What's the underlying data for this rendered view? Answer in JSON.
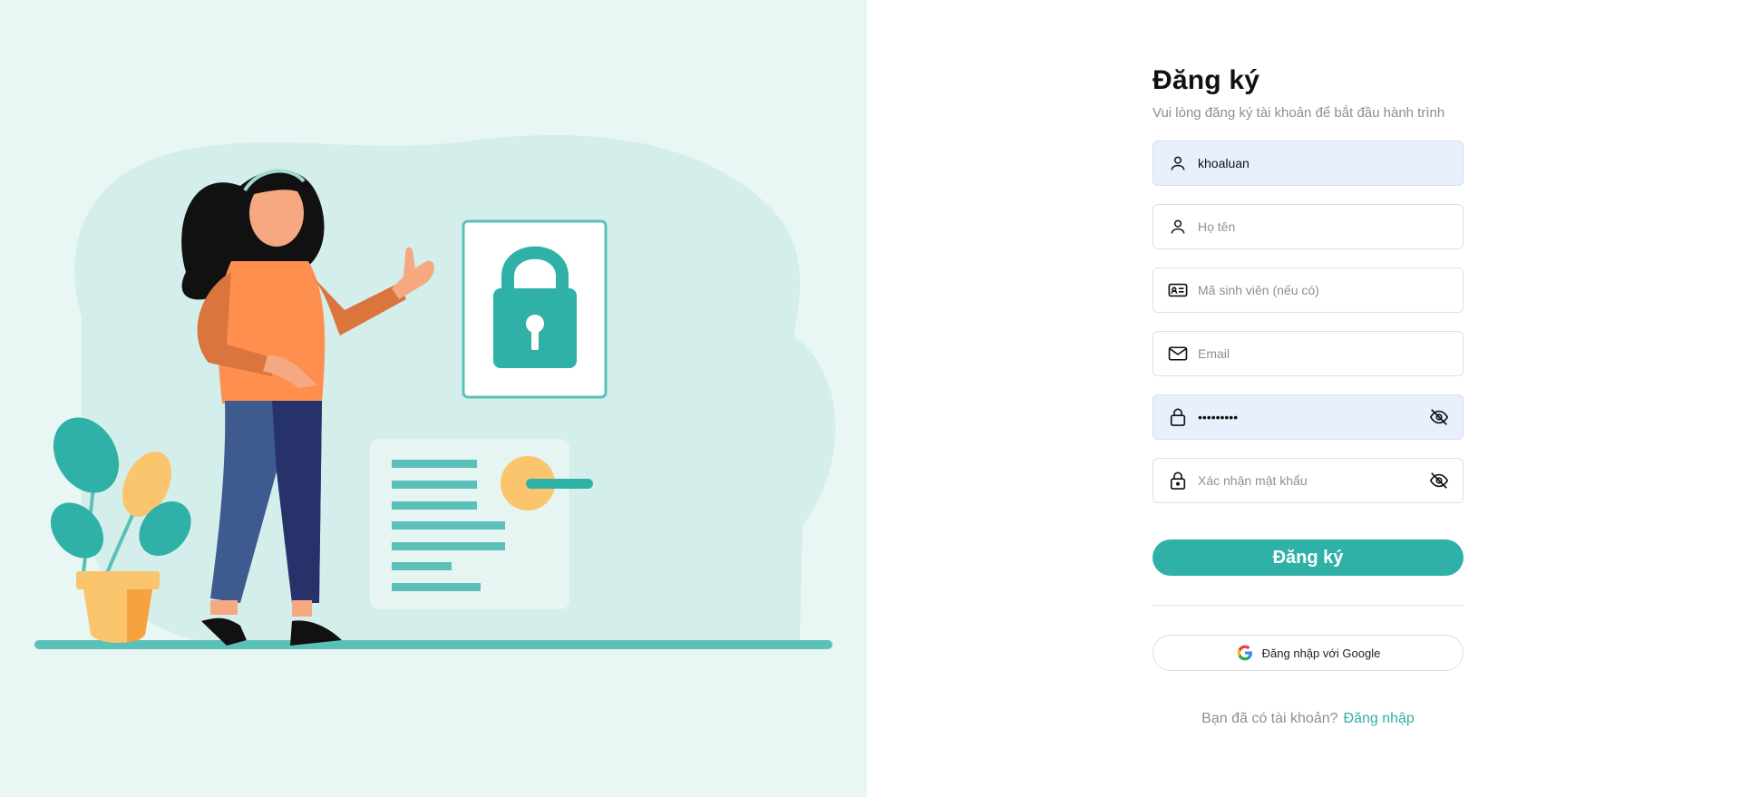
{
  "colors": {
    "accent": "#2fb1a8",
    "illustration_bg": "#e8f6f4",
    "blob": "#d4eeeb",
    "filled_input_bg": "#e8f0fe"
  },
  "illustration": {
    "name": "signup-illustration"
  },
  "form": {
    "title": "Đăng ký",
    "subtitle": "Vui lòng đăng ký tài khoản để bắt đầu hành trình",
    "username": {
      "value": "khoaluan",
      "placeholder": "",
      "icon": "user-icon"
    },
    "fullname": {
      "value": "",
      "placeholder": "Họ tên",
      "icon": "user-icon"
    },
    "student_id": {
      "value": "",
      "placeholder": "Mã sinh viên (nếu có)",
      "icon": "id-card-icon"
    },
    "email": {
      "value": "",
      "placeholder": "Email",
      "icon": "mail-icon"
    },
    "password": {
      "value": "•••••••••",
      "placeholder": "",
      "icon": "lock-icon"
    },
    "confirm_password": {
      "value": "",
      "placeholder": "Xác nhận mật khẩu",
      "icon": "lock-keyhole-icon"
    },
    "submit_label": "Đăng ký",
    "google_label": "Đăng nhập với Google",
    "footer_text": "Bạn đã có tài khoản?",
    "login_link": "Đăng nhập"
  }
}
